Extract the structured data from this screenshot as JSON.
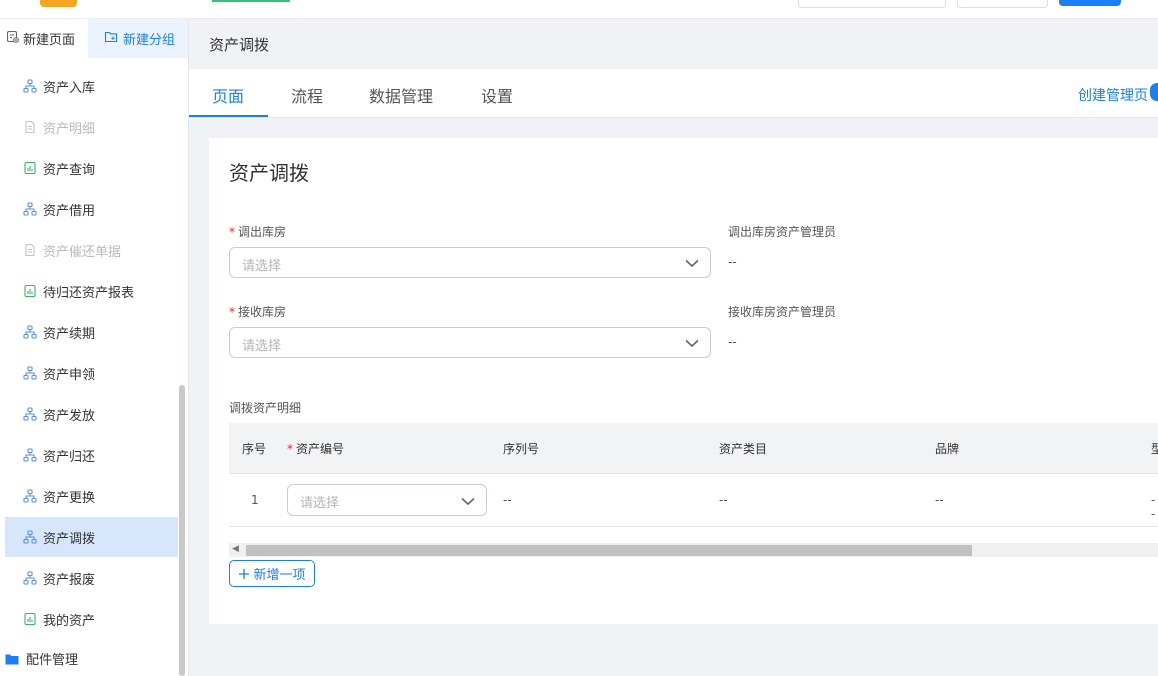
{
  "sidebar": {
    "new_page": "新建页面",
    "new_group": "新建分组",
    "items": [
      {
        "label": "资产入库",
        "icon": "flow-icon",
        "state": "normal"
      },
      {
        "label": "资产明细",
        "icon": "document-icon",
        "state": "disabled"
      },
      {
        "label": "资产查询",
        "icon": "report-icon",
        "state": "normal"
      },
      {
        "label": "资产借用",
        "icon": "flow-icon",
        "state": "normal"
      },
      {
        "label": "资产催还单据",
        "icon": "document-icon",
        "state": "disabled"
      },
      {
        "label": "待归还资产报表",
        "icon": "report-icon",
        "state": "normal"
      },
      {
        "label": "资产续期",
        "icon": "flow-icon",
        "state": "normal"
      },
      {
        "label": "资产申领",
        "icon": "flow-icon",
        "state": "normal"
      },
      {
        "label": "资产发放",
        "icon": "flow-icon",
        "state": "normal"
      },
      {
        "label": "资产归还",
        "icon": "flow-icon",
        "state": "normal"
      },
      {
        "label": "资产更换",
        "icon": "flow-icon",
        "state": "normal"
      },
      {
        "label": "资产调拨",
        "icon": "flow-icon",
        "state": "active"
      },
      {
        "label": "资产报废",
        "icon": "flow-icon",
        "state": "normal"
      },
      {
        "label": "我的资产",
        "icon": "report-icon",
        "state": "normal"
      }
    ],
    "folder": "配件管理"
  },
  "main": {
    "title": "资产调拨",
    "tabs": [
      "页面",
      "流程",
      "数据管理",
      "设置"
    ],
    "active_tab": "页面",
    "create_link": "创建管理页"
  },
  "form": {
    "title": "资产调拨",
    "out_warehouse_label": "调出库房",
    "out_warehouse_placeholder": "请选择",
    "out_admin_label": "调出库房资产管理员",
    "out_admin_value": "--",
    "in_warehouse_label": "接收库房",
    "in_warehouse_placeholder": "请选择",
    "in_admin_label": "接收库房资产管理员",
    "in_admin_value": "--",
    "detail_label": "调拨资产明细",
    "required_mark": "*",
    "table": {
      "headers": [
        "序号",
        "资产编号",
        "序列号",
        "资产类目",
        "品牌",
        "型"
      ],
      "rows": [
        {
          "index": "1",
          "asset_code_placeholder": "请选择",
          "serial": "--",
          "category": "--",
          "brand": "--",
          "model": "--"
        }
      ]
    },
    "add_button": "新增一项"
  },
  "colors": {
    "accent": "#1a7ff5",
    "active_bg": "#d6e6fb",
    "required": "#f5222d"
  }
}
